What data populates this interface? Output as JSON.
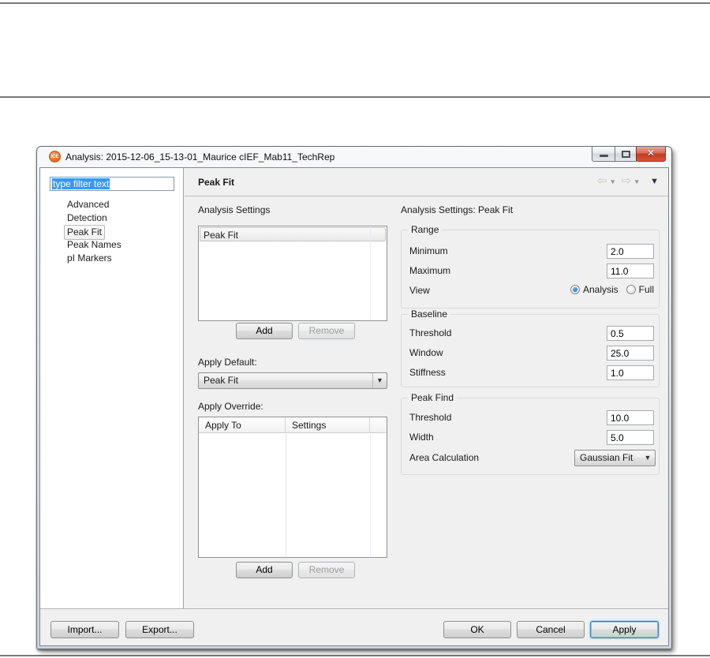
{
  "window": {
    "title": "Analysis: 2015-12-06_15-13-01_Maurice cIEF_Mab11_TechRep",
    "icon_text": "iCE",
    "accent_orange": "#e8702a",
    "close_glyph": "✕"
  },
  "sidebar": {
    "filter_text": "type filter text",
    "items": [
      "Advanced",
      "Detection",
      "Peak Fit",
      "Peak Names",
      "pI Markers"
    ],
    "selected_item": "Peak Fit",
    "selection_color": "#3399ff"
  },
  "header": {
    "title": "Peak Fit",
    "back_arrow": "⇦",
    "forward_arrow": "⇨",
    "caret": "▼"
  },
  "left_panel": {
    "analysis_settings": {
      "label": "Analysis Settings",
      "items": [
        "Peak Fit"
      ],
      "add": "Add",
      "remove": "Remove"
    },
    "apply_default": {
      "label": "Apply Default:",
      "value": "Peak Fit"
    },
    "apply_override": {
      "label": "Apply Override:",
      "columns": [
        "Apply To",
        "Settings"
      ],
      "rows": [],
      "add": "Add",
      "remove": "Remove"
    }
  },
  "right_panel": {
    "title": "Analysis Settings: Peak Fit",
    "range": {
      "title": "Range",
      "minimum_label": "Minimum",
      "minimum_value": "2.0",
      "maximum_label": "Maximum",
      "maximum_value": "11.0",
      "view_label": "View",
      "view_options": [
        {
          "label": "Analysis",
          "selected": true
        },
        {
          "label": "Full",
          "selected": false
        }
      ]
    },
    "baseline": {
      "title": "Baseline",
      "threshold_label": "Threshold",
      "threshold_value": "0.5",
      "window_label": "Window",
      "window_value": "25.0",
      "stiffness_label": "Stiffness",
      "stiffness_value": "1.0"
    },
    "peak_find": {
      "title": "Peak Find",
      "threshold_label": "Threshold",
      "threshold_value": "10.0",
      "width_label": "Width",
      "width_value": "5.0",
      "area_label": "Area Calculation",
      "area_value": "Gaussian Fit"
    }
  },
  "footer": {
    "import": "Import...",
    "export": "Export...",
    "ok": "OK",
    "cancel": "Cancel",
    "apply": "Apply"
  }
}
